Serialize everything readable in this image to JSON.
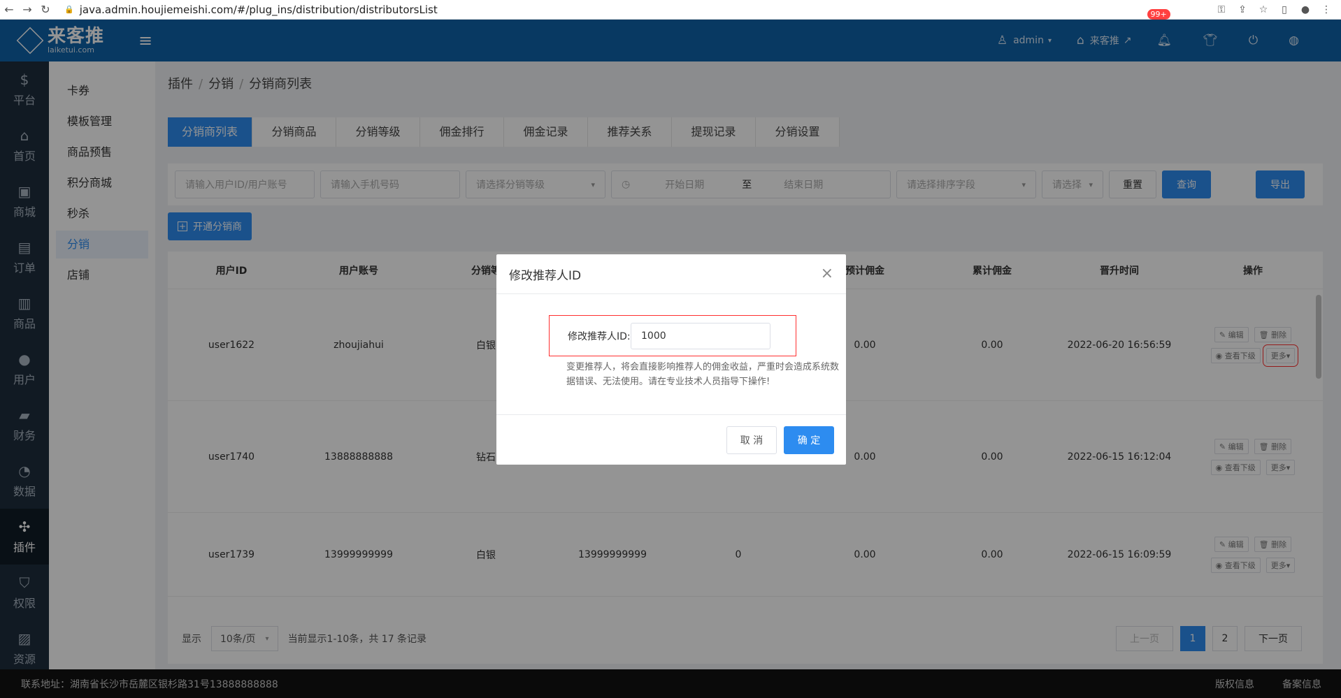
{
  "browser": {
    "url": "java.admin.houjiemeishi.com/#/plug_ins/distribution/distributorsList"
  },
  "header": {
    "logo_cn": "来客推",
    "logo_en": "laiketui.com",
    "user": "admin",
    "store": "来客推",
    "notification_count": "99+"
  },
  "sidenav": {
    "items": [
      {
        "label": "平台"
      },
      {
        "label": "首页"
      },
      {
        "label": "商城"
      },
      {
        "label": "订单"
      },
      {
        "label": "商品"
      },
      {
        "label": "用户"
      },
      {
        "label": "财务"
      },
      {
        "label": "数据"
      },
      {
        "label": "插件"
      },
      {
        "label": "权限"
      },
      {
        "label": "资源"
      }
    ]
  },
  "submenu": {
    "items": [
      {
        "label": "卡券"
      },
      {
        "label": "模板管理"
      },
      {
        "label": "商品预售"
      },
      {
        "label": "积分商城"
      },
      {
        "label": "秒杀"
      },
      {
        "label": "分销"
      },
      {
        "label": "店铺"
      }
    ]
  },
  "breadcrumb": [
    "插件",
    "分销",
    "分销商列表"
  ],
  "tabs": [
    "分销商列表",
    "分销商品",
    "分销等级",
    "佣金排行",
    "佣金记录",
    "推荐关系",
    "提现记录",
    "分销设置"
  ],
  "filters": {
    "user_placeholder": "请输入用户ID/用户账号",
    "phone_placeholder": "请输入手机号码",
    "level_placeholder": "请选择分销等级",
    "start_date": "开始日期",
    "to": "至",
    "end_date": "结束日期",
    "sort_placeholder": "请选择排序字段",
    "order_placeholder": "请选择",
    "reset": "重置",
    "query": "查询",
    "export": "导出"
  },
  "open_button": "开通分销商",
  "table": {
    "headers": [
      "用户ID",
      "用户账号",
      "分销等",
      "预计佣金",
      "累计佣金",
      "晋升时间",
      "操作"
    ],
    "rows": [
      {
        "id": "user1622",
        "account": "zhoujiahui",
        "level": "白银",
        "est": "0.00",
        "total": "0.00",
        "time": "2022-06-20 16:56:59"
      },
      {
        "id": "user1740",
        "account": "13888888888",
        "level": "钻石",
        "est": "0.00",
        "total": "0.00",
        "time": "2022-06-15 16:12:04"
      },
      {
        "id": "user1739",
        "account": "13999999999",
        "level": "白银",
        "phone": "13999999999",
        "count": "0",
        "est": "0.00",
        "total": "0.00",
        "time": "2022-06-15 16:09:59"
      }
    ],
    "ops": {
      "edit": "编辑",
      "delete": "删除",
      "sub": "查看下级",
      "more": "更多"
    }
  },
  "pager": {
    "show": "显示",
    "page_size": "10条/页",
    "summary": "当前显示1-10条，共 17 条记录",
    "prev": "上一页",
    "pages": [
      "1",
      "2"
    ],
    "next": "下一页"
  },
  "footer": {
    "address": "联系地址：湖南省长沙市岳麓区银杉路31号13888888888",
    "copyright": "版权信息",
    "record": "备案信息"
  },
  "modal": {
    "title": "修改推荐人ID",
    "label": "修改推荐人ID:",
    "value": "1000",
    "warning": "变更推荐人，将会直接影响推荐人的佣金收益，严重时会造成系统数据错误、无法使用。请在专业技术人员指导下操作!",
    "cancel": "取 消",
    "confirm": "确 定"
  }
}
